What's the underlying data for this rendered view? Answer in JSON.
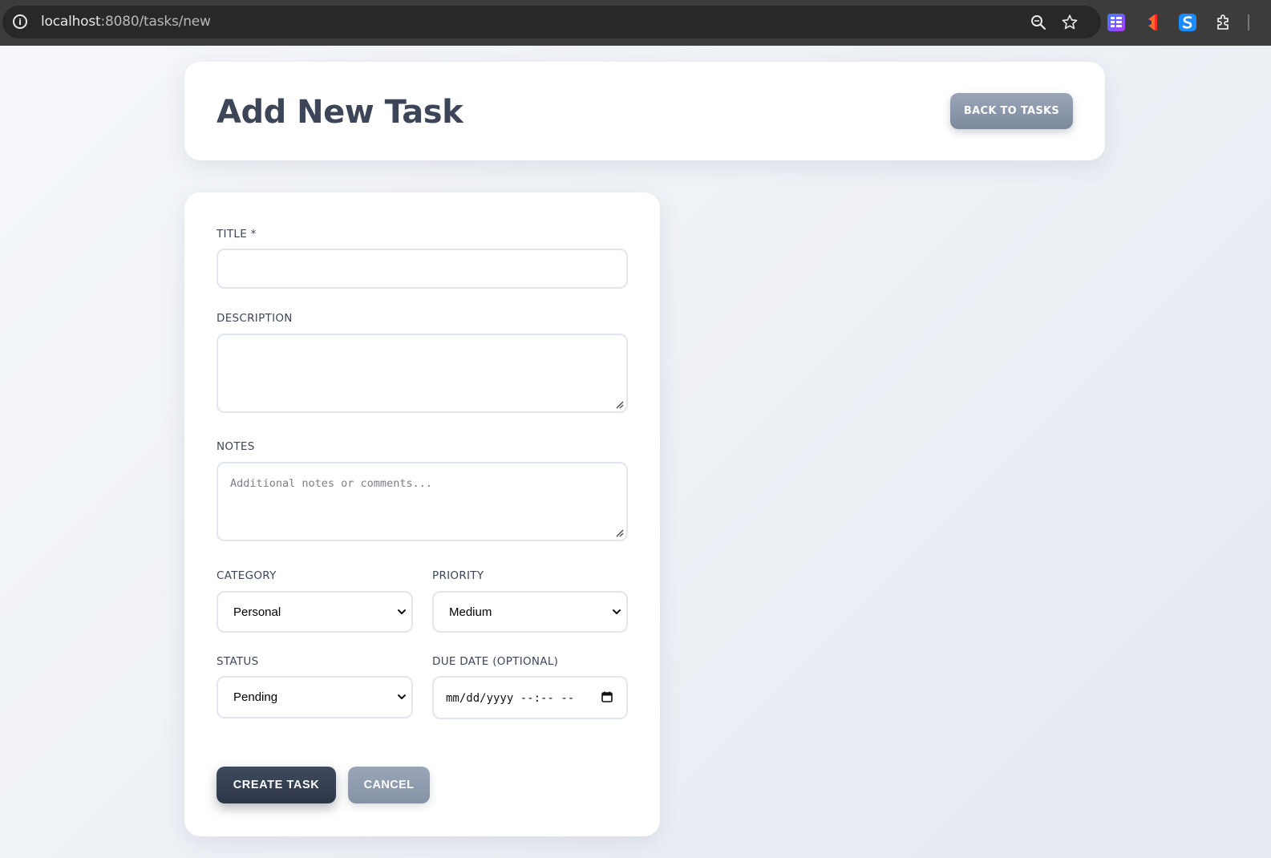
{
  "browser": {
    "url_host": "localhost",
    "url_path": ":8080/tasks/new",
    "extensions": [
      "grid-extension-icon",
      "flag-extension-icon",
      "s-extension-icon",
      "puzzle-extensions-icon"
    ]
  },
  "header": {
    "title": "Add New Task",
    "back_label": "BACK TO TASKS"
  },
  "form": {
    "title_label": "TITLE *",
    "title_value": "",
    "description_label": "DESCRIPTION",
    "description_value": "",
    "notes_label": "NOTES",
    "notes_placeholder": "Additional notes or comments...",
    "category_label": "CATEGORY",
    "category_value": "Personal",
    "priority_label": "PRIORITY",
    "priority_value": "Medium",
    "status_label": "STATUS",
    "status_value": "Pending",
    "due_date_label": "DUE DATE (OPTIONAL)",
    "due_date_value": "mm/dd/yyyy --:-- --",
    "create_label": "CREATE TASK",
    "cancel_label": "CANCEL"
  },
  "colors": {
    "page_background": "#eef1f5",
    "card": "#ffffff",
    "text": "#3d4658",
    "primary_button": "#36404f",
    "secondary_button": "#8e9aad",
    "input_border": "#e2e6ee"
  }
}
